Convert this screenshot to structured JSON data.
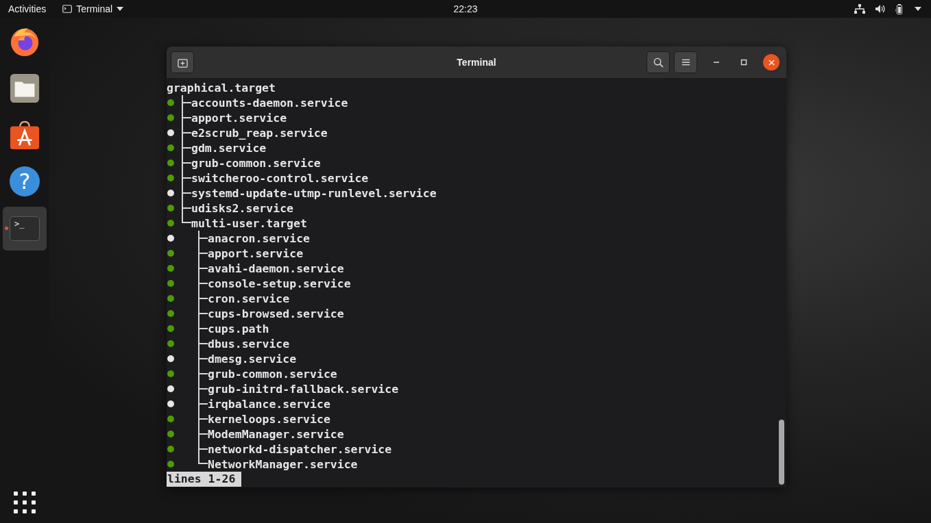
{
  "top_bar": {
    "activities": "Activities",
    "app_menu": {
      "label": "Terminal"
    },
    "clock": "22:23"
  },
  "dock": {
    "items": [
      {
        "kind": "firefox",
        "running": false,
        "selected": false
      },
      {
        "kind": "files",
        "running": false,
        "selected": false
      },
      {
        "kind": "software",
        "running": false,
        "selected": false
      },
      {
        "kind": "help",
        "glyph": "?",
        "running": false,
        "selected": false
      },
      {
        "kind": "terminal",
        "glyph": ">_",
        "running": true,
        "selected": true
      }
    ]
  },
  "window": {
    "title": "Terminal"
  },
  "terminal": {
    "tree": {
      "name": "graphical.target",
      "children": [
        {
          "name": "accounts-daemon.service",
          "active": true
        },
        {
          "name": "apport.service",
          "active": true
        },
        {
          "name": "e2scrub_reap.service",
          "active": false
        },
        {
          "name": "gdm.service",
          "active": true
        },
        {
          "name": "grub-common.service",
          "active": true
        },
        {
          "name": "switcheroo-control.service",
          "active": true
        },
        {
          "name": "systemd-update-utmp-runlevel.service",
          "active": false
        },
        {
          "name": "udisks2.service",
          "active": true
        },
        {
          "name": "multi-user.target",
          "active": true,
          "children": [
            {
              "name": "anacron.service",
              "active": false
            },
            {
              "name": "apport.service",
              "active": true
            },
            {
              "name": "avahi-daemon.service",
              "active": true
            },
            {
              "name": "console-setup.service",
              "active": true
            },
            {
              "name": "cron.service",
              "active": true
            },
            {
              "name": "cups-browsed.service",
              "active": true
            },
            {
              "name": "cups.path",
              "active": true
            },
            {
              "name": "dbus.service",
              "active": true
            },
            {
              "name": "dmesg.service",
              "active": false
            },
            {
              "name": "grub-common.service",
              "active": true
            },
            {
              "name": "grub-initrd-fallback.service",
              "active": false
            },
            {
              "name": "irqbalance.service",
              "active": false
            },
            {
              "name": "kerneloops.service",
              "active": true
            },
            {
              "name": "ModemManager.service",
              "active": true
            },
            {
              "name": "networkd-dispatcher.service",
              "active": true
            },
            {
              "name": "NetworkManager.service",
              "active": true
            }
          ]
        }
      ]
    },
    "status_line": "lines 1-26"
  }
}
